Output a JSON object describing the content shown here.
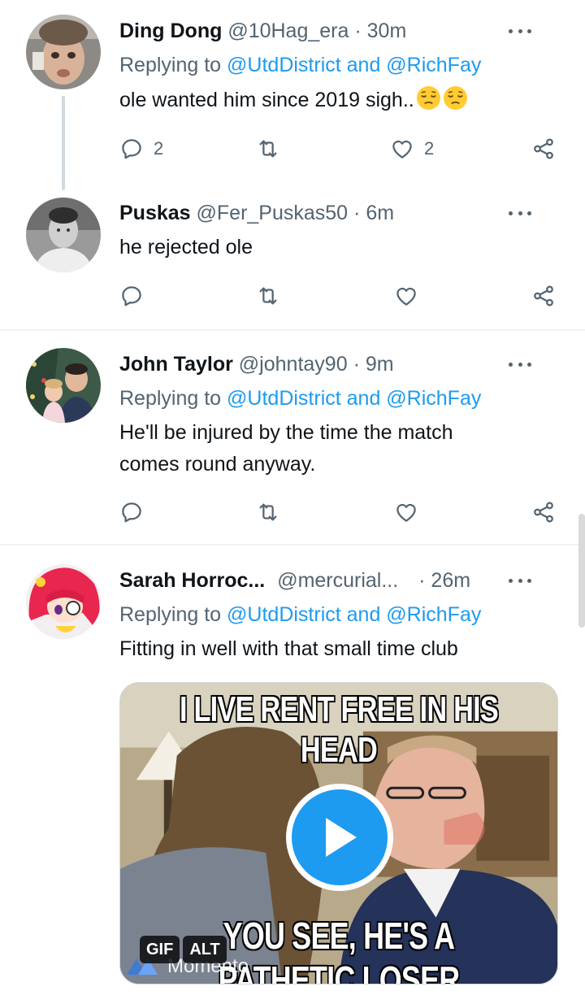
{
  "tweets": [
    {
      "name": "Ding Dong",
      "handle": "@10Hag_era",
      "time": "· 30m",
      "replying_prefix": "Replying to",
      "replying_to": "@UtdDistrict and @RichFay",
      "text": "ole wanted him since 2019 sigh..",
      "emojis": [
        "pensive-face",
        "pensive-face"
      ],
      "reply_count": "2",
      "retweet_count": "",
      "like_count": "2"
    },
    {
      "name": "Puskas",
      "handle": "@Fer_Puskas50",
      "time": "· 6m",
      "text": "he rejected ole",
      "reply_count": "",
      "retweet_count": "",
      "like_count": ""
    },
    {
      "name": "John Taylor",
      "handle": "@johntay90",
      "time": "· 9m",
      "replying_prefix": "Replying to",
      "replying_to": "@UtdDistrict and @RichFay",
      "text": "He'll be injured by the time the match comes round anyway.",
      "reply_count": "",
      "retweet_count": "",
      "like_count": ""
    },
    {
      "name": "Sarah Horroc...",
      "handle": "@mercurial...",
      "time": "· 26m",
      "replying_prefix": "Replying to",
      "replying_to": "@UtdDistrict and @RichFay",
      "text": "Fitting in well with that small time club",
      "media": {
        "caption_top": "I LIVE RENT FREE IN HIS HEAD",
        "caption_bottom": "YOU SEE, HE'S A PATHETIC LOSER",
        "badge_gif": "GIF",
        "badge_alt": "ALT",
        "watermark": "Momento",
        "play_icon": "play-icon"
      }
    }
  ],
  "colors": {
    "accent": "#1d9bf0",
    "secondary_text": "#536471",
    "divider": "#eff3f4"
  }
}
